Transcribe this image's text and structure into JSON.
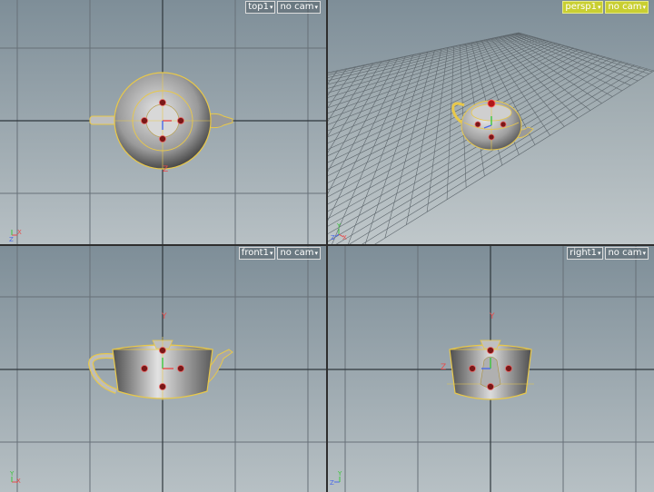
{
  "viewports": {
    "top": {
      "view_label": "top1",
      "camera_label": "no cam"
    },
    "persp": {
      "view_label": "persp1",
      "camera_label": "no cam"
    },
    "front": {
      "view_label": "front1",
      "camera_label": "no cam"
    },
    "right": {
      "view_label": "right1",
      "camera_label": "no cam"
    }
  },
  "axis_labels": {
    "x": "X",
    "y": "Y",
    "z": "Z"
  },
  "colors": {
    "accent": "#c9cf32",
    "axis_x": "#e84a4a",
    "axis_y": "#3cc83c",
    "axis_z": "#4a6ae8",
    "selection": "#e8c84a"
  },
  "icons": {
    "dropdown": "chevron-down-icon",
    "manipulator": "transform-handle-icon"
  }
}
